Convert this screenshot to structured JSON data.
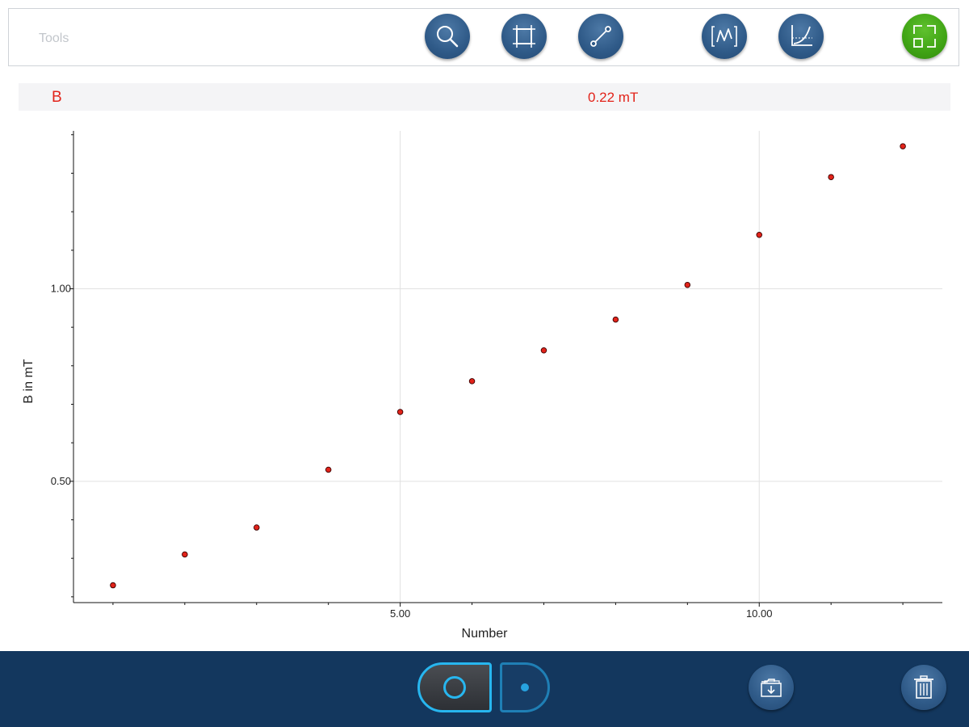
{
  "toolbar": {
    "title": "Tools",
    "buttons": [
      {
        "icon": "magnifier-icon",
        "color": "#2f5a88"
      },
      {
        "icon": "crop-icon",
        "color": "#2f5a88"
      },
      {
        "icon": "line-tool-icon",
        "color": "#2f5a88"
      },
      {
        "icon": "curve-fit-icon",
        "color": "#2f5a88"
      },
      {
        "icon": "axes-graph-icon",
        "color": "#2f5a88"
      },
      {
        "icon": "layout-icon",
        "color": "#3fa314"
      }
    ]
  },
  "measurement": {
    "name": "B",
    "value": "0.22 mT",
    "color": "#e2231a"
  },
  "chart_data": {
    "type": "scatter",
    "x": [
      1,
      2,
      3,
      4,
      5,
      6,
      7,
      8,
      9,
      10,
      11,
      12
    ],
    "y": [
      0.23,
      0.31,
      0.38,
      0.53,
      0.68,
      0.76,
      0.84,
      0.92,
      1.01,
      1.14,
      1.29,
      1.37
    ],
    "xlabel": "Number",
    "ylabel": "B in mT",
    "xlim": [
      0.45,
      12.55
    ],
    "ylim": [
      0.185,
      1.41
    ],
    "xticks": [
      5,
      10
    ],
    "xtick_labels": [
      "5.00",
      "10.00"
    ],
    "yticks": [
      0.5,
      1.0
    ],
    "ytick_labels": [
      "0.50",
      "1.00"
    ],
    "y_minor_step": 0.1,
    "x_minor_step": 1,
    "grid": true,
    "marker_color": "#e2231a"
  },
  "bottom": {
    "mode_left": "ring-mode-icon",
    "mode_right": "dot-mode-icon",
    "export_icon": "folder-export-icon",
    "delete_icon": "trash-icon"
  }
}
